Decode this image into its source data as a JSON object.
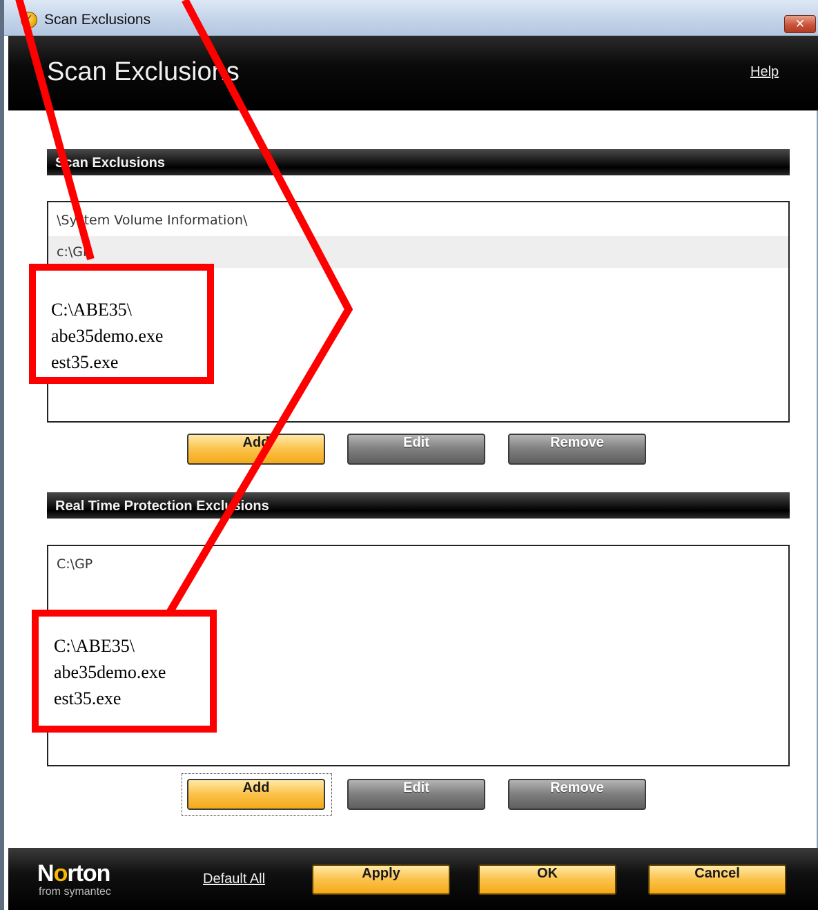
{
  "window": {
    "title": "Scan Exclusions",
    "close_label": "✕"
  },
  "header": {
    "title": "Scan Exclusions",
    "help_label": "Help"
  },
  "scan_section": {
    "heading": "Scan Exclusions",
    "items": [
      "\\System Volume Information\\",
      "c:\\GP"
    ],
    "buttons": {
      "add": "Add",
      "edit": "Edit",
      "remove": "Remove"
    }
  },
  "realtime_section": {
    "heading": "Real Time Protection Exclusions",
    "items": [
      "C:\\GP"
    ],
    "buttons": {
      "add": "Add",
      "edit": "Edit",
      "remove": "Remove"
    }
  },
  "footer": {
    "logo": {
      "name_pre": "N",
      "name_o": "o",
      "name_post": "rton",
      "tagline": "from symantec"
    },
    "default_all": "Default All",
    "apply": "Apply",
    "ok": "OK",
    "cancel": "Cancel"
  },
  "annotations": [
    {
      "lines": [
        "C:\\ABE35\\",
        "abe35demo.exe",
        "est35.exe"
      ]
    },
    {
      "lines": [
        "C:\\ABE35\\",
        "abe35demo.exe",
        "est35.exe"
      ]
    }
  ],
  "colors": {
    "annotation": "#ff0000",
    "accent_button": "#fbc24a",
    "header_bg": "#000000"
  }
}
